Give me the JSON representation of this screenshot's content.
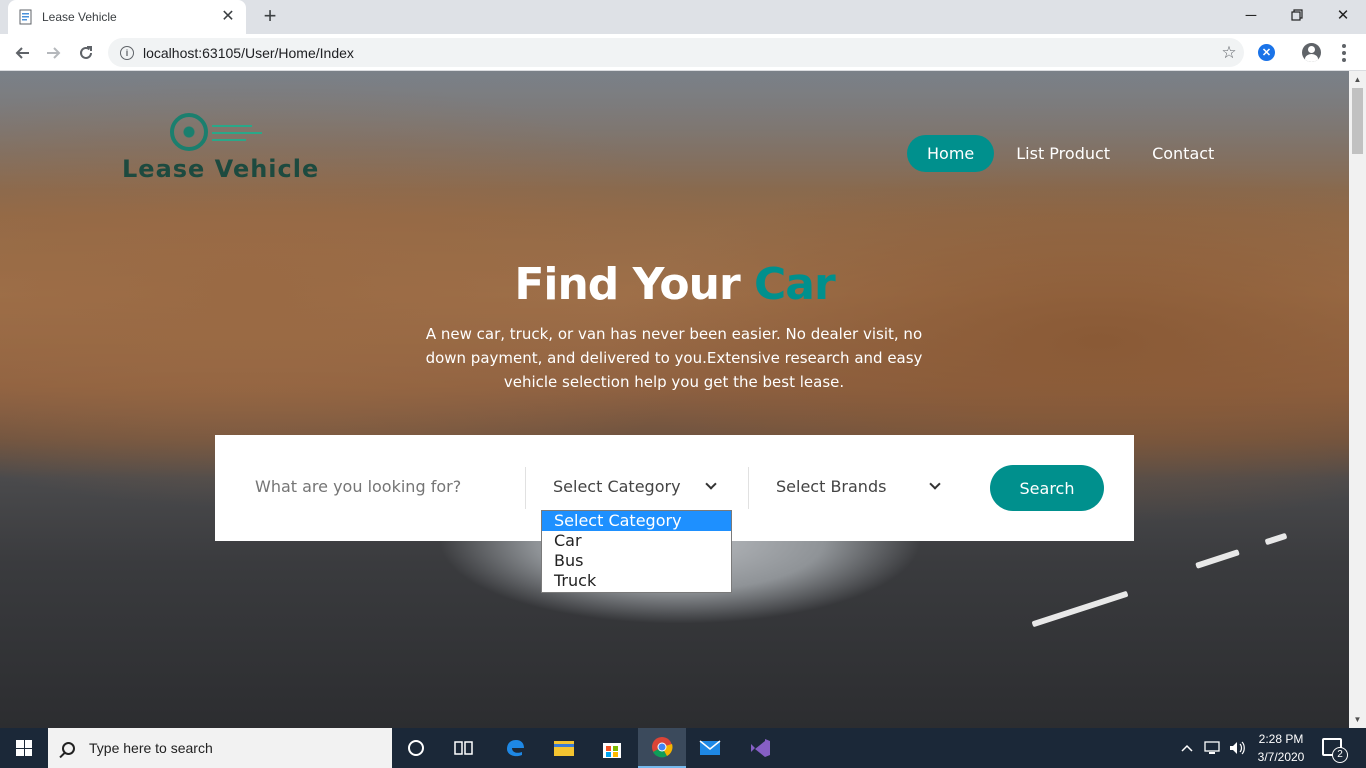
{
  "browser": {
    "tab_title": "Lease Vehicle",
    "url": "localhost:63105/User/Home/Index"
  },
  "site": {
    "logo_text": "Lease Vehicle",
    "nav": [
      {
        "label": "Home",
        "active": true
      },
      {
        "label": "List Product",
        "active": false
      },
      {
        "label": "Contact",
        "active": false
      }
    ],
    "hero": {
      "title_main": "Find Your",
      "title_accent": "Car",
      "description": "A new car, truck, or van has never been easier. No dealer visit, no down payment, and delivered to you.Extensive research and easy vehicle selection help you get the best lease."
    },
    "search": {
      "placeholder": "What are you looking for?",
      "category_selected": "Select Category",
      "brands_selected": "Select Brands",
      "button_label": "Search"
    },
    "category_options": [
      "Select Category",
      "Car",
      "Bus",
      "Truck"
    ]
  },
  "colors": {
    "accent": "#00908d",
    "dropdown_highlight": "#1e90ff"
  },
  "taskbar": {
    "search_placeholder": "Type here to search",
    "time": "2:28 PM",
    "date": "3/7/2020",
    "notification_count": "2"
  }
}
